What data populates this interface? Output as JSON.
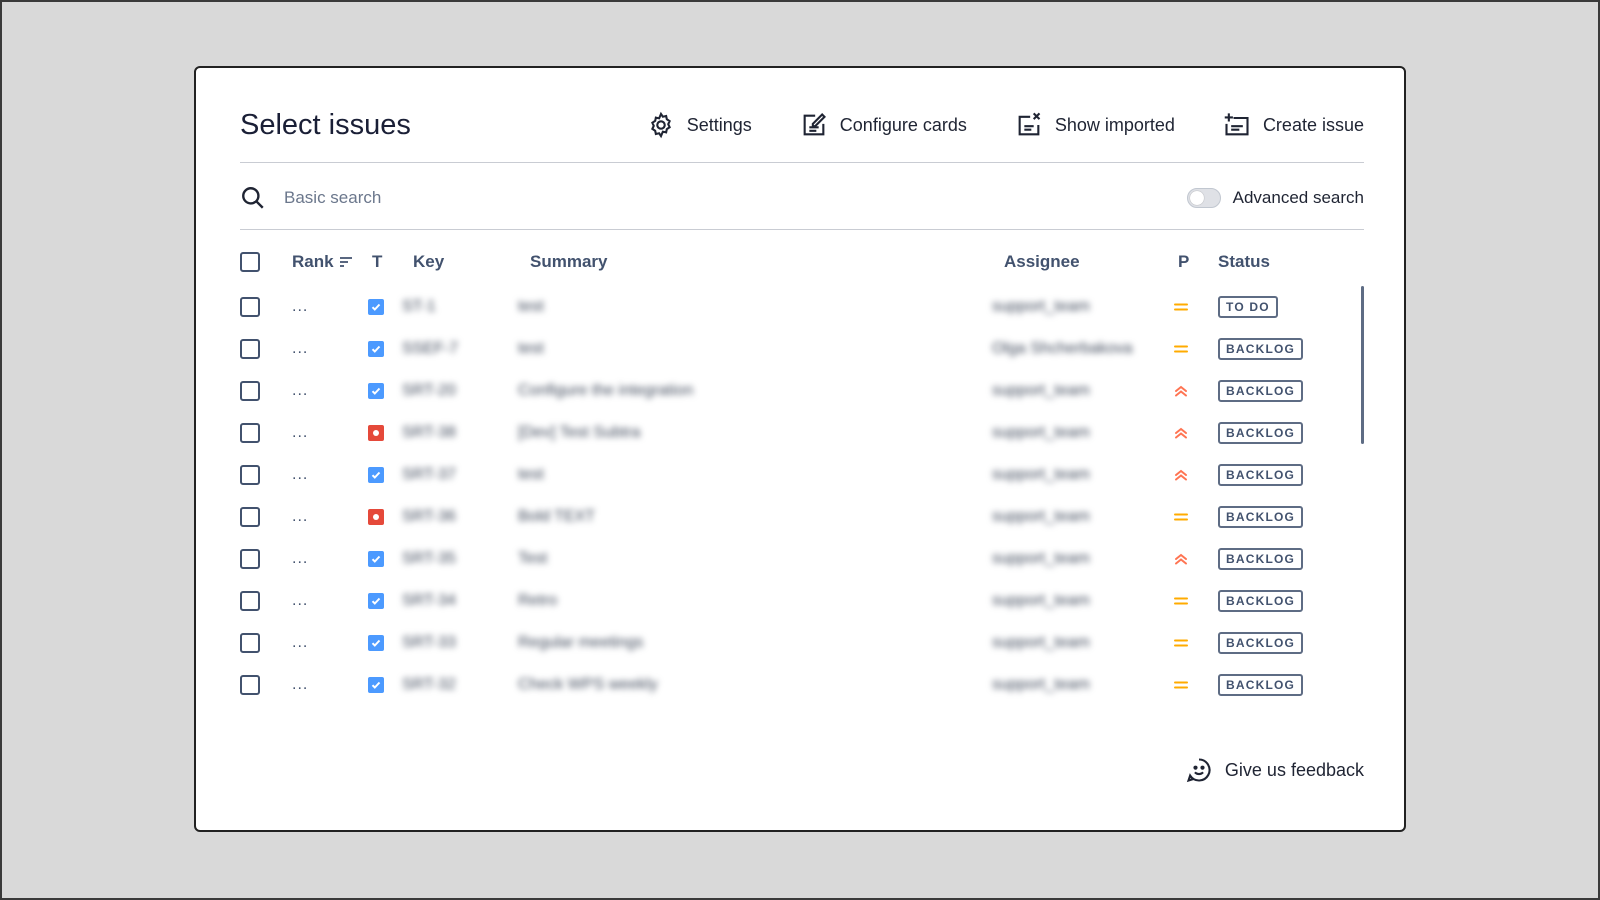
{
  "dialog": {
    "title": "Select issues",
    "actions": {
      "settings": "Settings",
      "configure_cards": "Configure cards",
      "show_imported": "Show imported",
      "create_issue": "Create issue"
    }
  },
  "search": {
    "placeholder": "Basic search",
    "advanced_label": "Advanced search",
    "advanced_enabled": false
  },
  "table": {
    "headers": {
      "rank": "Rank",
      "type": "T",
      "key": "Key",
      "summary": "Summary",
      "assignee": "Assignee",
      "priority": "P",
      "status": "Status"
    },
    "rows": [
      {
        "rank": "...",
        "type": "task",
        "key": "ST-1",
        "summary": "test",
        "assignee": "support_team",
        "priority": "medium",
        "status": "TO DO"
      },
      {
        "rank": "...",
        "type": "task",
        "key": "SSEF-7",
        "summary": "test",
        "assignee": "Olga Shcherbakova",
        "priority": "medium",
        "status": "BACKLOG"
      },
      {
        "rank": "...",
        "type": "task",
        "key": "SRT-20",
        "summary": "Configure the integration",
        "assignee": "support_team",
        "priority": "high",
        "status": "BACKLOG"
      },
      {
        "rank": "...",
        "type": "bug",
        "key": "SRT-38",
        "summary": "[Dev] Test Subtra",
        "assignee": "support_team",
        "priority": "high",
        "status": "BACKLOG"
      },
      {
        "rank": "...",
        "type": "task",
        "key": "SRT-37",
        "summary": "test",
        "assignee": "support_team",
        "priority": "high",
        "status": "BACKLOG"
      },
      {
        "rank": "...",
        "type": "bug",
        "key": "SRT-36",
        "summary": "Bold TEXT",
        "assignee": "support_team",
        "priority": "medium",
        "status": "BACKLOG"
      },
      {
        "rank": "...",
        "type": "task",
        "key": "SRT-35",
        "summary": "Test",
        "assignee": "support_team",
        "priority": "high",
        "status": "BACKLOG"
      },
      {
        "rank": "...",
        "type": "task",
        "key": "SRT-34",
        "summary": "Retro",
        "assignee": "support_team",
        "priority": "medium",
        "status": "BACKLOG"
      },
      {
        "rank": "...",
        "type": "task",
        "key": "SRT-33",
        "summary": "Regular meetings",
        "assignee": "support_team",
        "priority": "medium",
        "status": "BACKLOG"
      },
      {
        "rank": "...",
        "type": "task",
        "key": "SRT-32",
        "summary": "Check WPS weekly",
        "assignee": "support_team",
        "priority": "medium",
        "status": "BACKLOG"
      }
    ]
  },
  "footer": {
    "feedback": "Give us feedback"
  },
  "colors": {
    "task": "#4c9aff",
    "bug": "#e5493a",
    "priority_medium": "#ffab00",
    "priority_high": "#ff7452"
  }
}
